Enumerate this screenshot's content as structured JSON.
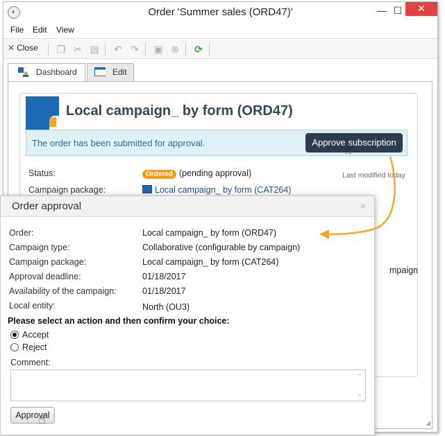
{
  "window": {
    "title": "Order 'Summer sales (ORD47)'",
    "close_glyph": "✕",
    "minimize_glyph": "—",
    "maximize_glyph": "☐"
  },
  "menu": [
    "File",
    "Edit",
    "View"
  ],
  "toolbar": {
    "close_label": "Close",
    "icons": [
      "copy-icon",
      "cut-icon",
      "paste-icon",
      "undo-icon",
      "redo-icon",
      "save-icon",
      "cancel-icon",
      "refresh-icon"
    ]
  },
  "tabs": [
    {
      "label": "Dashboard",
      "active": true
    },
    {
      "label": "Edit",
      "active": false
    }
  ],
  "dashboard": {
    "title": "Local campaign_ by form (ORD47)",
    "notice": "The order has been submitted for approval.",
    "approve_button": "Approve subscription",
    "status_label": "Status:",
    "status_badge": "Ordered",
    "status_text": "(pending approval)",
    "last_modified": "Last modified today",
    "package_label": "Campaign package:",
    "package_value": "Local campaign_ by form (CAT264)",
    "partial_text": "mpaign"
  },
  "dialog": {
    "title": "Order approval",
    "close_glyph": "×",
    "fields": [
      {
        "label": "Order:",
        "value": "Local campaign_ by form (ORD47)",
        "link": true
      },
      {
        "label": "Campaign type:",
        "value": "Collaborative (configurable by campaign)",
        "link": false
      },
      {
        "label": "Campaign package:",
        "value": "Local campaign_ by form (CAT264)",
        "link": true
      },
      {
        "label": "Approval deadline:",
        "value": "01/18/2017",
        "link": false
      },
      {
        "label": "Availability of the campaign:",
        "value": "01/18/2017",
        "link": false
      },
      {
        "label": "Local entity:",
        "value": "North (OU3)",
        "link": false
      }
    ],
    "prompt": "Please select an action and then confirm your choice:",
    "options": [
      {
        "label": "Accept",
        "selected": true
      },
      {
        "label": "Reject",
        "selected": false
      }
    ],
    "comment_label": "Comment:",
    "comment_value": "",
    "approval_button": "Approval"
  },
  "colors": {
    "accent": "#1c69b4",
    "notice_bg": "#dff1f7",
    "approve_btn": "#2e3d4e",
    "badge": "#f39c12",
    "arrow": "#f5a623",
    "link": "#1d4e9a"
  }
}
